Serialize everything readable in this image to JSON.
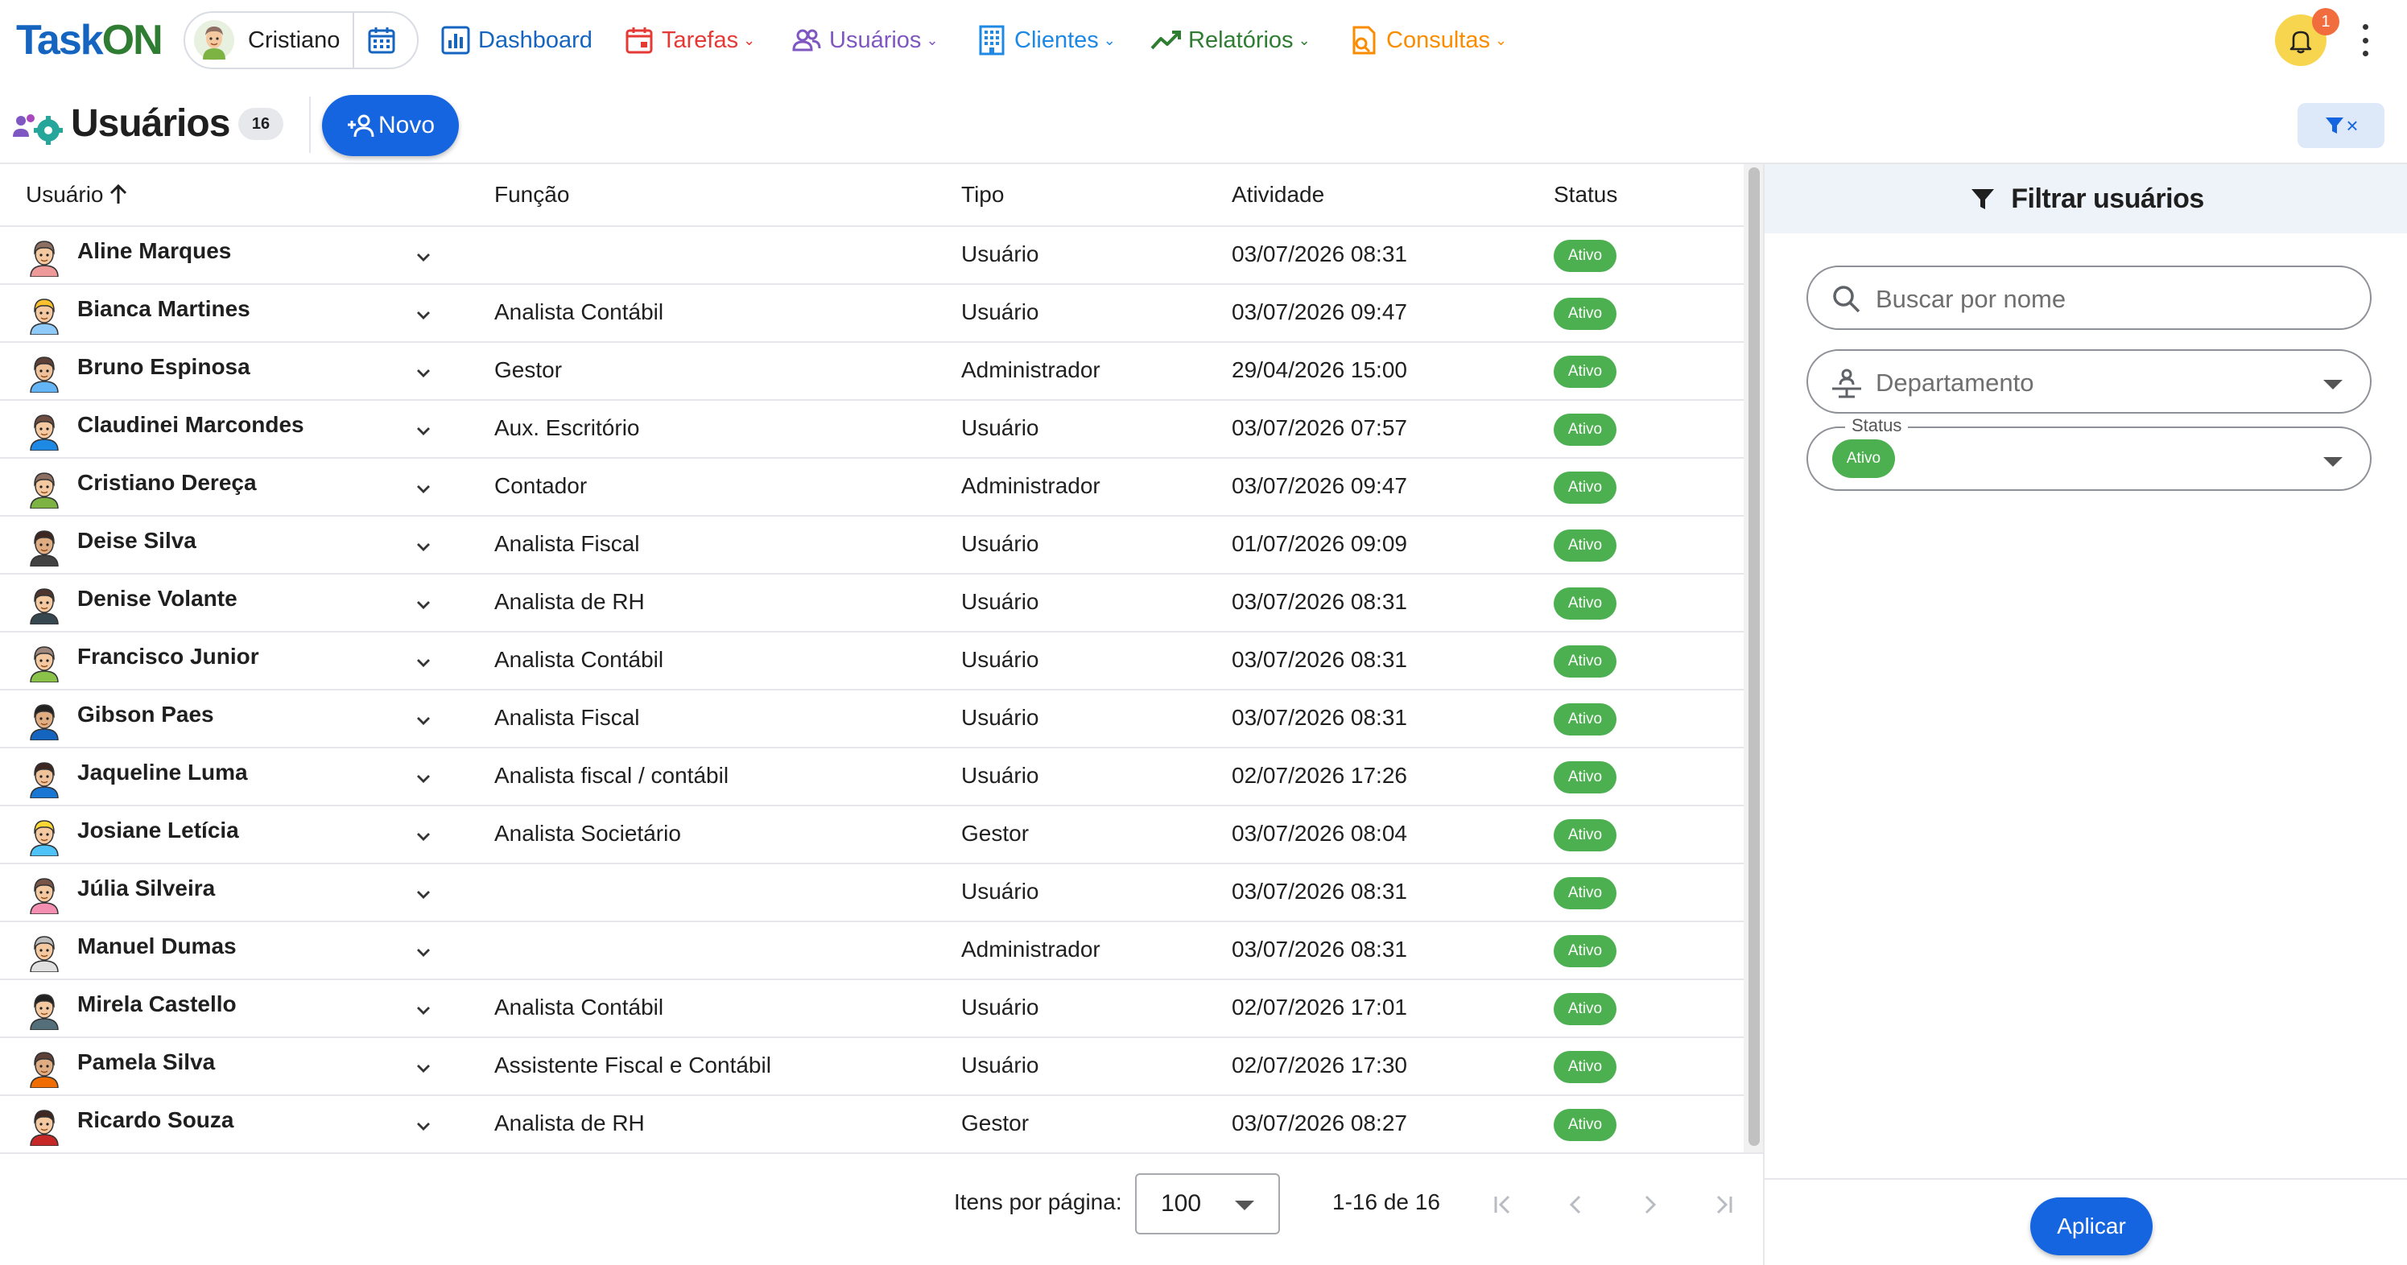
{
  "app": {
    "logo_part1": "Task",
    "logo_part2": "ON",
    "user_name": "Cristiano"
  },
  "nav": {
    "items": [
      {
        "label": "Dashboard",
        "color": "#1565c0",
        "icon": "dashboard-icon"
      },
      {
        "label": "Tarefas",
        "color": "#e53935",
        "icon": "calendar-icon"
      },
      {
        "label": "Usuários",
        "color": "#7e57c2",
        "icon": "users-icon"
      },
      {
        "label": "Clientes",
        "color": "#1e88e5",
        "icon": "building-icon"
      },
      {
        "label": "Relatórios",
        "color": "#2e7d32",
        "icon": "trend-icon"
      },
      {
        "label": "Consultas",
        "color": "#fb8c00",
        "icon": "search-doc-icon"
      }
    ],
    "notification_count": "1"
  },
  "page": {
    "title": "Usuários",
    "count": "16",
    "new_button": "Novo"
  },
  "table": {
    "columns": [
      "Usuário",
      "Função",
      "Tipo",
      "Atividade",
      "Status"
    ],
    "rows": [
      {
        "name": "Aline Marques",
        "role": "",
        "type": "Usuário",
        "activity": "03/07/2026 08:31",
        "status": "Ativo"
      },
      {
        "name": "Bianca Martines",
        "role": "Analista Contábil",
        "type": "Usuário",
        "activity": "03/07/2026 09:47",
        "status": "Ativo"
      },
      {
        "name": "Bruno Espinosa",
        "role": "Gestor",
        "type": "Administrador",
        "activity": "29/04/2026 15:00",
        "status": "Ativo"
      },
      {
        "name": "Claudinei Marcondes",
        "role": "Aux. Escritório",
        "type": "Usuário",
        "activity": "03/07/2026 07:57",
        "status": "Ativo"
      },
      {
        "name": "Cristiano Dereça",
        "role": "Contador",
        "type": "Administrador",
        "activity": "03/07/2026 09:47",
        "status": "Ativo"
      },
      {
        "name": "Deise Silva",
        "role": "Analista Fiscal",
        "type": "Usuário",
        "activity": "01/07/2026 09:09",
        "status": "Ativo"
      },
      {
        "name": "Denise Volante",
        "role": "Analista de RH",
        "type": "Usuário",
        "activity": "03/07/2026 08:31",
        "status": "Ativo"
      },
      {
        "name": "Francisco Junior",
        "role": "Analista Contábil",
        "type": "Usuário",
        "activity": "03/07/2026 08:31",
        "status": "Ativo"
      },
      {
        "name": "Gibson Paes",
        "role": "Analista Fiscal",
        "type": "Usuário",
        "activity": "03/07/2026 08:31",
        "status": "Ativo"
      },
      {
        "name": "Jaqueline Luma",
        "role": "Analista fiscal / contábil",
        "type": "Usuário",
        "activity": "02/07/2026 17:26",
        "status": "Ativo"
      },
      {
        "name": "Josiane Letícia",
        "role": "Analista Societário",
        "type": "Gestor",
        "activity": "03/07/2026 08:04",
        "status": "Ativo"
      },
      {
        "name": "Júlia Silveira",
        "role": "",
        "type": "Usuário",
        "activity": "03/07/2026 08:31",
        "status": "Ativo"
      },
      {
        "name": "Manuel Dumas",
        "role": "",
        "type": "Administrador",
        "activity": "03/07/2026 08:31",
        "status": "Ativo"
      },
      {
        "name": "Mirela Castello",
        "role": "Analista Contábil",
        "type": "Usuário",
        "activity": "02/07/2026 17:01",
        "status": "Ativo"
      },
      {
        "name": "Pamela Silva",
        "role": "Assistente Fiscal e Contábil",
        "type": "Usuário",
        "activity": "02/07/2026 17:30",
        "status": "Ativo"
      },
      {
        "name": "Ricardo Souza",
        "role": "Analista de RH",
        "type": "Gestor",
        "activity": "03/07/2026 08:27",
        "status": "Ativo"
      }
    ]
  },
  "pagination": {
    "items_per_page_label": "Itens por página:",
    "items_per_page_value": "100",
    "range": "1-16 de 16"
  },
  "filter_panel": {
    "title": "Filtrar usuários",
    "search_placeholder": "Buscar por nome",
    "department_placeholder": "Departamento",
    "status_label": "Status",
    "status_chip": "Ativo",
    "apply_button": "Aplicar"
  },
  "colors": {
    "primary": "#1565e0",
    "status_active": "#4caf50",
    "bell": "#f8d54e",
    "badge": "#f26d3d"
  }
}
